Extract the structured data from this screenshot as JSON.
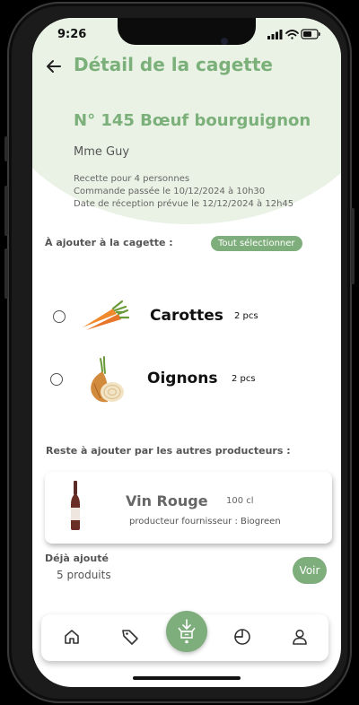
{
  "status_bar": {
    "time": "9:26"
  },
  "header": {
    "title": "Détail de la cagette"
  },
  "order": {
    "title": "N° 145 Bœuf bourguignon",
    "customer": "Mme Guy",
    "recipe": "Recette pour 4 personnes",
    "ordered": "Commande passée le 10/12/2024 à 10h30",
    "delivery": "Date de réception prévue le 12/12/2024 à 12h45"
  },
  "add_section": {
    "label": "À ajouter à la cagette :",
    "select_all": "Tout sélectionner",
    "items": [
      {
        "name": "Carottes",
        "qty": "2 pcs",
        "icon": "carrot-image",
        "selected": false
      },
      {
        "name": "Oignons",
        "qty": "2 pcs",
        "icon": "onion-image",
        "selected": false
      }
    ]
  },
  "others_section": {
    "label": "Reste à ajouter par les autres producteurs :",
    "item": {
      "name": "Vin Rouge",
      "volume": "100 cl",
      "producer": "producteur fournisseur : Biogreen",
      "icon": "wine-bottle-image"
    }
  },
  "already_added": {
    "label": "Déjà ajouté",
    "count": "5 produits",
    "button": "Voir"
  },
  "nav": {
    "items": [
      "home-icon",
      "tag-icon",
      "crate-download-icon",
      "chart-pie-icon",
      "user-icon"
    ],
    "active": "crate-download-icon"
  },
  "colors": {
    "accent": "#7fae7d",
    "title_green": "#7bb07a",
    "blob": "#e9f2e4"
  }
}
